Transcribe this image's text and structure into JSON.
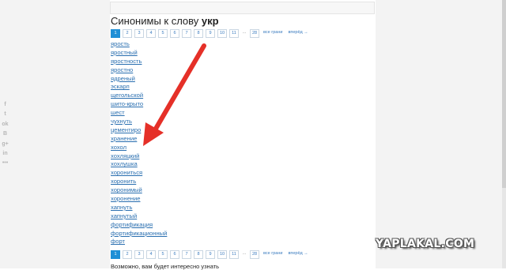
{
  "heading": {
    "prefix": "Синонимы к слову",
    "word": "укр"
  },
  "pagination": {
    "pages": [
      "1",
      "2",
      "3",
      "4",
      "5",
      "6",
      "7",
      "8",
      "9",
      "10",
      "11",
      "...",
      "28"
    ],
    "active": "1",
    "back": "все грани",
    "next": "вперёд →"
  },
  "words": [
    "ярость",
    "яростный",
    "яростность",
    "яростно",
    "ядреный",
    "эскарп",
    "щегольской",
    "шито-крыто",
    "шест",
    "чухнуть",
    "цементиро",
    "хранение",
    "хохол",
    "хохляцкий",
    "хохлушка",
    "хорониться",
    "хоронить",
    "хоронимый",
    "хоронение",
    "хапнуть",
    "хапнутый",
    "фортификация",
    "фортификационный",
    "форт"
  ],
  "social": [
    "f",
    "t",
    "ok",
    "B",
    "g+",
    "in",
    "•••"
  ],
  "watermark": "YAPLAKAL.COM",
  "footer": "Возможно, вам будет интересно узнать",
  "colors": {
    "accent": "#1f8fd6",
    "link": "#2a6fb0",
    "arrow": "#e53028"
  }
}
